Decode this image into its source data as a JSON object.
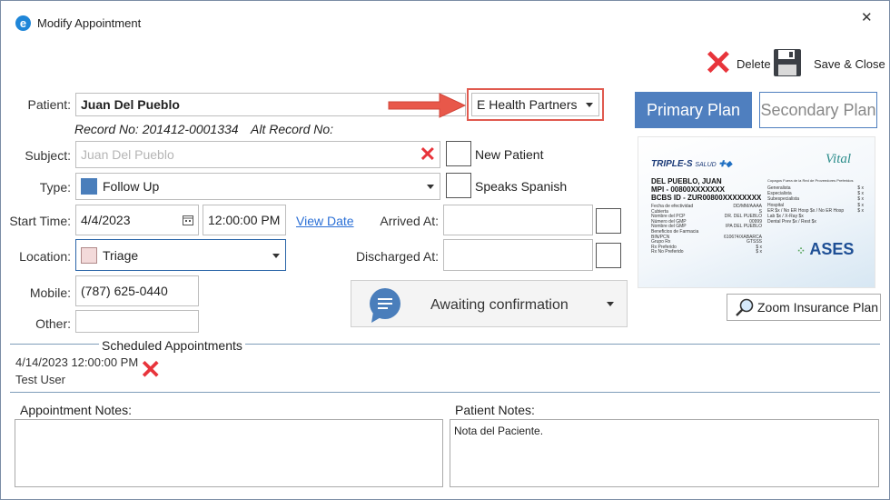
{
  "window": {
    "title": "Modify Appointment",
    "close_glyph": "✕"
  },
  "toolbar": {
    "delete_label": "Delete",
    "save_close_label": "Save & Close"
  },
  "patient": {
    "label": "Patient:",
    "name": "Juan Del Pueblo",
    "record_no": "Record No: 201412-0001334",
    "alt_record_no": "Alt Record No:"
  },
  "insurer": {
    "value": "E Health Partners"
  },
  "subject": {
    "label": "Subject:",
    "placeholder": "Juan Del Pueblo"
  },
  "new_patient": {
    "label": "New Patient"
  },
  "type": {
    "label": "Type:",
    "value": "Follow Up",
    "color": "#4a7ebb"
  },
  "speaks_spanish": {
    "label": "Speaks Spanish"
  },
  "start": {
    "label": "Start Time:",
    "date": "4/4/2023",
    "time": "12:00:00 PM",
    "view_date": "View Date"
  },
  "arrived": {
    "label": "Arrived At:"
  },
  "location": {
    "label": "Location:",
    "value": "Triage",
    "color": "#f3dada"
  },
  "discharged": {
    "label": "Discharged At:"
  },
  "mobile": {
    "label": "Mobile:",
    "value": "(787) 625-0440"
  },
  "other": {
    "label": "Other:",
    "value": ""
  },
  "status": {
    "value": "Awaiting confirmation"
  },
  "plans": {
    "primary": "Primary Plan",
    "secondary": "Secondary Plan"
  },
  "card": {
    "brand": "TRIPLE-S",
    "brand_sub": "SALUD",
    "vital": "Vital",
    "member": "DEL PUEBLO, JUAN",
    "mpi": "MPI - 00800XXXXXXX",
    "bcbs": "BCBS ID - ZUR00800XXXXXXXX",
    "copay_title": "Copagos Fuera de la Red de Proveedores Preferidos",
    "rows_left": [
      [
        "Fecha de efectividad",
        "DD/MM/AAAA"
      ],
      [
        "Cubierta",
        "S"
      ],
      [
        "Nombre del PCP",
        "DR. DEL PUEBLO"
      ],
      [
        "Número del GMP",
        "00999"
      ],
      [
        "Nombre del GMP",
        "IPA DEL PUEBLO"
      ],
      [
        "Beneficios de Farmacia",
        ""
      ],
      [
        "BIN/PCN",
        "610674/XABARCA"
      ],
      [
        "Grupo Rx",
        "GTSSS"
      ],
      [
        "Rx Preferido",
        "$ x"
      ],
      [
        "Rx No Preferido",
        "$ x"
      ]
    ],
    "rows_right": [
      [
        "Generalista",
        "$ x"
      ],
      [
        "Especialista",
        "$ x"
      ],
      [
        "Subespecialista",
        "$ x"
      ],
      [
        "Hospital",
        "$ x"
      ],
      [
        "ER $x / No ER Hosp $x / No ER Hosp",
        "$ x"
      ],
      [
        "Lab $x / X-Ray $x",
        ""
      ],
      [
        "Dental Prev $x / Rest $x",
        ""
      ]
    ],
    "ases": "ASES"
  },
  "zoom": {
    "label": "Zoom Insurance Plan"
  },
  "scheduled": {
    "title": "Scheduled Appointments",
    "items": [
      {
        "datetime": "4/14/2023 12:00:00 PM",
        "user": "Test User"
      }
    ]
  },
  "notes": {
    "appointment_label": "Appointment Notes:",
    "appointment_value": "",
    "patient_label": "Patient Notes:",
    "patient_value": "Nota del Paciente."
  },
  "colors": {
    "accent": "#4a7ebb",
    "primary_plan_bg": "#4f7fbf",
    "red_x": "#e8343b",
    "arrow": "#e8584a",
    "highlight_border": "#e05a4f"
  }
}
